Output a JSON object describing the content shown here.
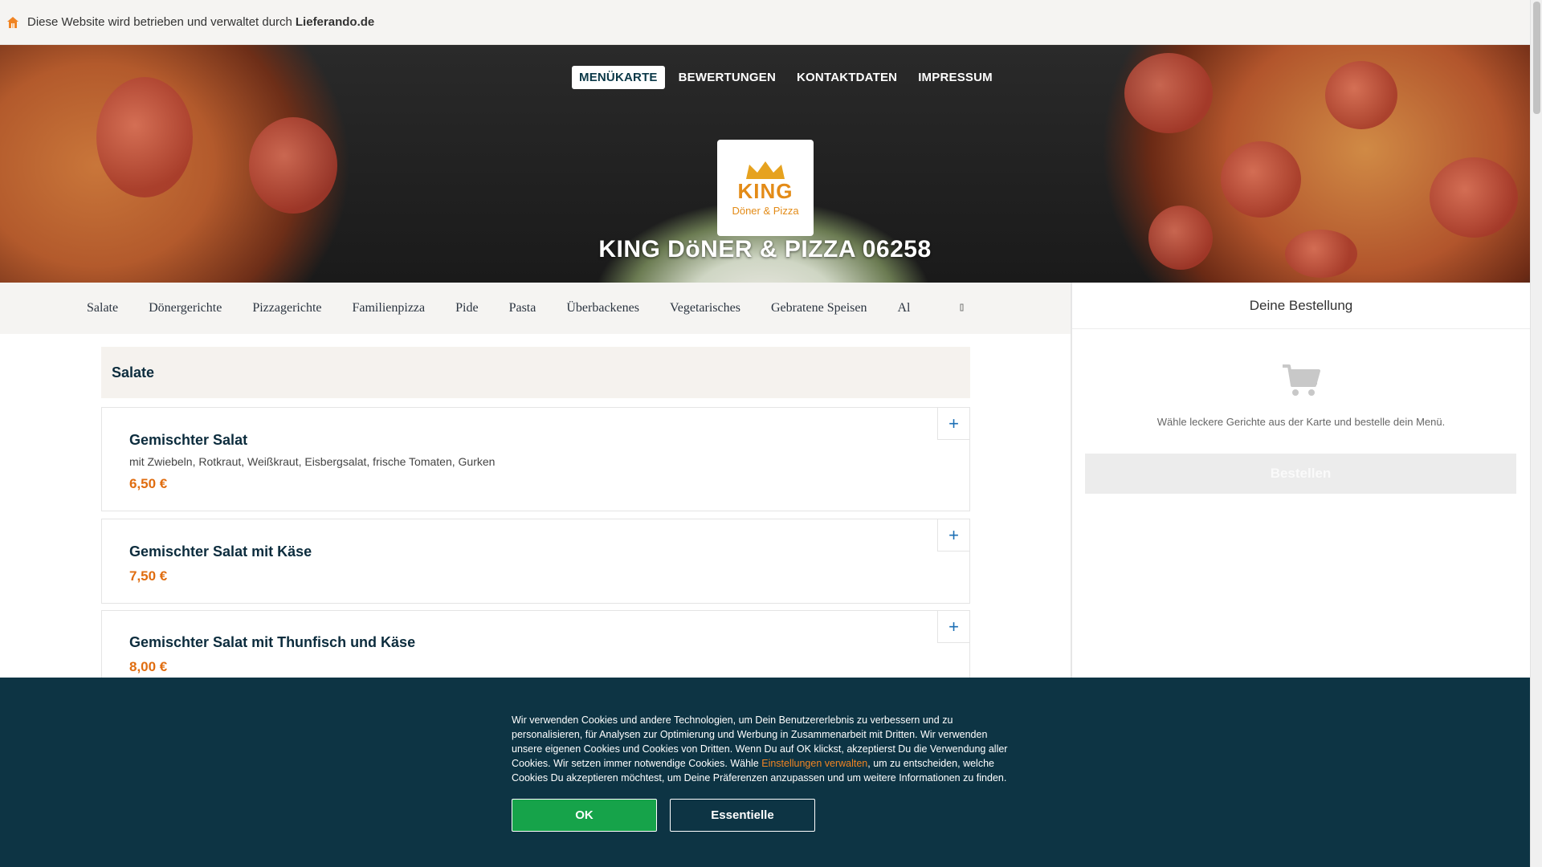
{
  "infobar": {
    "text": "Diese Website wird betrieben und verwaltet durch",
    "brand": "Lieferando.de"
  },
  "nav": {
    "menu": "MENÜKARTE",
    "reviews": "BEWERTUNGEN",
    "contact": "KONTAKTDATEN",
    "imprint": "IMPRESSUM"
  },
  "logo": {
    "line1": "KING",
    "line2": "Döner & Pizza"
  },
  "restaurant": {
    "name": "KING DöNER & PIZZA 06258"
  },
  "categories": [
    "Salate",
    "Dönergerichte",
    "Pizzagerichte",
    "Familienpizza",
    "Pide",
    "Pasta",
    "Überbackenes",
    "Vegetarisches",
    "Gebratene Speisen",
    "Al"
  ],
  "section": {
    "title": "Salate"
  },
  "items": [
    {
      "name": "Gemischter Salat",
      "desc": "mit Zwiebeln, Rotkraut, Weißkraut, Eisbergsalat, frische Tomaten, Gurken",
      "price": "6,50 €"
    },
    {
      "name": "Gemischter Salat mit Käse",
      "desc": "",
      "price": "7,50 €"
    },
    {
      "name": "Gemischter Salat mit Thunfisch und Käse",
      "desc": "",
      "price": "8,00 €"
    }
  ],
  "add_symbol": "+",
  "cart": {
    "title": "Deine Bestellung",
    "empty_text": "Wähle leckere Gerichte aus der Karte und bestelle dein Menü.",
    "order_button": "Bestellen"
  },
  "cookie": {
    "text_before": "Wir verwenden Cookies und andere Technologien, um Dein Benutzererlebnis zu verbessern und zu personalisieren, für Analysen zur Optimierung und Werbung in Zusammenarbeit mit Dritten. Wir verwenden unsere eigenen Cookies und Cookies von Dritten. Wenn Du auf OK klickst, akzeptierst Du die Verwendung aller Cookies. Wir setzen immer notwendige Cookies. Wähle ",
    "link": "Einstellungen verwalten",
    "text_after": ", um zu entscheiden, welche Cookies Du akzeptieren möchtest, um Deine Präferenzen anzupassen und um weitere Informationen zu finden.",
    "ok": "OK",
    "essential": "Essentielle"
  },
  "colors": {
    "brand_orange": "#f08423",
    "price_orange": "#e06d10",
    "cookie_bg": "#0d3444",
    "ok_green": "#16a34a"
  }
}
